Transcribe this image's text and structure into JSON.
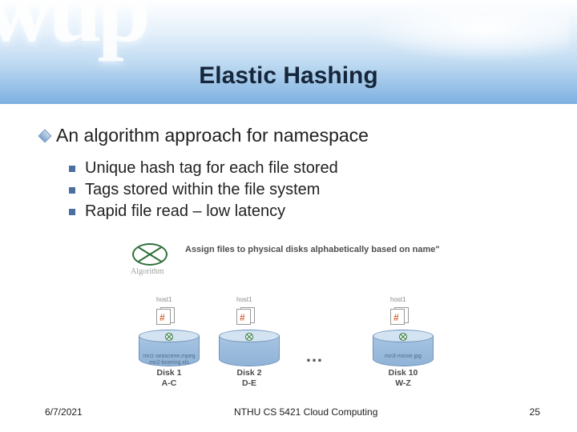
{
  "bg_letters": "wup",
  "title": "Elastic Hashing",
  "main_bullet": "An algorithm approach for namespace",
  "sub_bullets": [
    "Unique hash tag for each file stored",
    "Tags stored within the file system",
    "Rapid file read – low latency"
  ],
  "diagram": {
    "algorithm_label": "Algorithm",
    "assign_text": "Assign files to physical disks alphabetically based on name\"",
    "host_label": "host1",
    "hash_symbol": "#",
    "dots": "…",
    "disks": [
      {
        "name": "Disk 1",
        "range": "A-C",
        "body": "mn1-seascene.mpeg\nmn2-boering.xls"
      },
      {
        "name": "Disk 2",
        "range": "D-E",
        "body": " "
      },
      {
        "name": "Disk 10",
        "range": "W-Z",
        "body": "mn3-movie.jpg"
      }
    ]
  },
  "footer": {
    "date": "6/7/2021",
    "course": "NTHU CS 5421 Cloud Computing",
    "page": "25"
  }
}
